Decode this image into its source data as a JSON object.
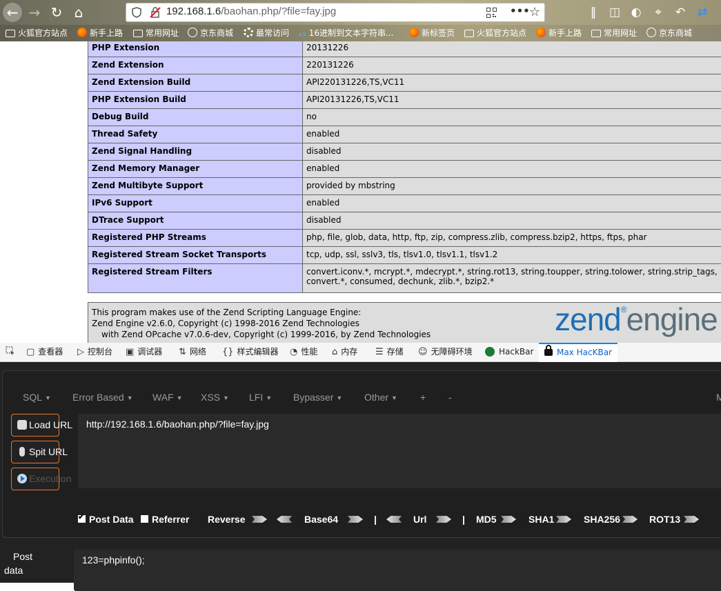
{
  "browser": {
    "url_host": "192.168.1.6",
    "url_path": "/baohan.php/?file=fay.jpg",
    "bookmarks": [
      "火狐官方站点",
      "新手上路",
      "常用网址",
      "京东商城",
      "最常访问",
      "16进制到文本字符串...",
      "新标签页",
      "火狐官方站点",
      "新手上路",
      "常用网址",
      "京东商城"
    ],
    "bookmark_icons": [
      "folder",
      "fox",
      "folder",
      "globe",
      "gear",
      "code",
      "fox",
      "folder",
      "fox",
      "folder",
      "globe"
    ]
  },
  "phpinfo": {
    "rows": [
      {
        "key": "PHP Extension",
        "value": "20131226"
      },
      {
        "key": "Zend Extension",
        "value": "220131226"
      },
      {
        "key": "Zend Extension Build",
        "value": "API220131226,TS,VC11"
      },
      {
        "key": "PHP Extension Build",
        "value": "API20131226,TS,VC11"
      },
      {
        "key": "Debug Build",
        "value": "no"
      },
      {
        "key": "Thread Safety",
        "value": "enabled"
      },
      {
        "key": "Zend Signal Handling",
        "value": "disabled"
      },
      {
        "key": "Zend Memory Manager",
        "value": "enabled"
      },
      {
        "key": "Zend Multibyte Support",
        "value": "provided by mbstring"
      },
      {
        "key": "IPv6 Support",
        "value": "enabled"
      },
      {
        "key": "DTrace Support",
        "value": "disabled"
      },
      {
        "key": "Registered PHP Streams",
        "value": "php, file, glob, data, http, ftp, zip, compress.zlib, compress.bzip2, https, ftps, phar"
      },
      {
        "key": "Registered Stream Socket Transports",
        "value": "tcp, udp, ssl, sslv3, tls, tlsv1.0, tlsv1.1, tlsv1.2"
      },
      {
        "key": "Registered Stream Filters",
        "value": "convert.iconv.*, mcrypt.*, mdecrypt.*, string.rot13, string.toupper, string.tolower, string.strip_tags, convert.*, consumed, dechunk, zlib.*, bzip2.*"
      }
    ],
    "zend_line1": "This program makes use of the Zend Scripting Language Engine:",
    "zend_line2": "Zend Engine v2.6.0, Copyright (c) 1998-2016 Zend Technologies",
    "zend_line3": "with Zend OPcache v7.0.6-dev, Copyright (c) 1999-2016, by Zend Technologies",
    "zend_logo_a": "zend",
    "zend_logo_b": "engine"
  },
  "devtools": {
    "tabs": [
      {
        "label": "查看器",
        "icon": "inspector-icon"
      },
      {
        "label": "控制台",
        "icon": "console-icon"
      },
      {
        "label": "调试器",
        "icon": "debugger-icon"
      },
      {
        "label": "网络",
        "icon": "network-icon"
      },
      {
        "label": "样式编辑器",
        "icon": "style-editor-icon"
      },
      {
        "label": "性能",
        "icon": "performance-icon"
      },
      {
        "label": "内存",
        "icon": "memory-icon"
      },
      {
        "label": "存储",
        "icon": "storage-icon"
      },
      {
        "label": "无障碍环境",
        "icon": "accessibility-icon"
      },
      {
        "label": "HackBar",
        "icon": "hackbar-icon"
      },
      {
        "label": "Max HacKBar",
        "icon": "lock-icon"
      }
    ],
    "active_tab": "Max HacKBar"
  },
  "hackbar": {
    "menu": [
      "SQL",
      "Error Based",
      "WAF",
      "XSS",
      "LFI",
      "Bypasser",
      "Other",
      "+",
      "-",
      "M"
    ],
    "load_url": "Load URL",
    "split_url": "Spit URL",
    "execution": "Execution",
    "url_value": "http://192.168.1.6/baohan.php/?file=fay.jpg",
    "post_data_label": "Post Data",
    "referrer_label": "Referrer",
    "reverse": "Reverse",
    "base64": "Base64",
    "url": "Url",
    "md5": "MD5",
    "sha1": "SHA1",
    "sha256": "SHA256",
    "rot13": "ROT13",
    "separator": "|",
    "post_label_1": "Post",
    "post_label_2": "data",
    "post_value": "123=phpinfo();",
    "post_data_checked": true,
    "referrer_checked": false,
    "accent_color": "#e8762d"
  }
}
